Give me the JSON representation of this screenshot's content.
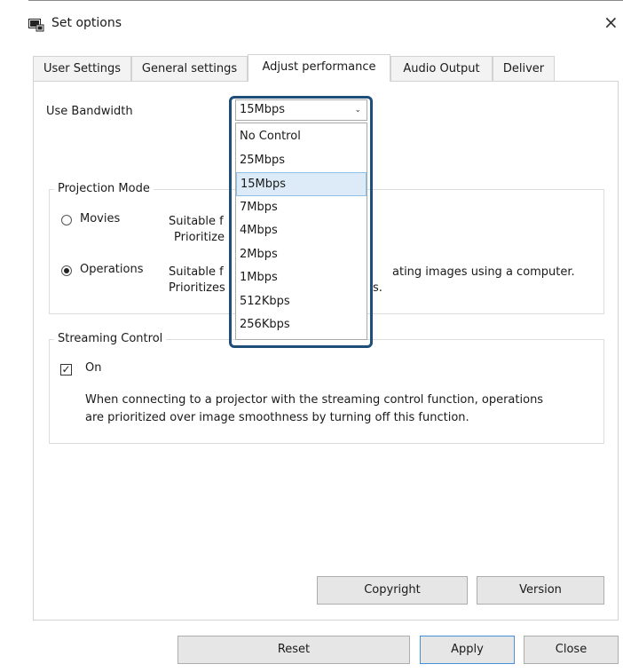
{
  "window": {
    "title": "Set options",
    "close_glyph": "×"
  },
  "tabs": [
    {
      "label": "User Settings"
    },
    {
      "label": "General settings"
    },
    {
      "label": "Adjust performance"
    },
    {
      "label": "Audio Output"
    },
    {
      "label": "Deliver"
    }
  ],
  "bandwidth": {
    "label": "Use Bandwidth",
    "selected": "15Mbps",
    "options": [
      "No Control",
      "25Mbps",
      "15Mbps",
      "7Mbps",
      "4Mbps",
      "2Mbps",
      "1Mbps",
      "512Kbps",
      "256Kbps"
    ]
  },
  "projection_mode": {
    "title": "Projection Mode",
    "movies": {
      "label": "Movies",
      "desc_line1": "Suitable f",
      "desc_line2": "Prioritize"
    },
    "operations": {
      "label": "Operations",
      "desc_line1": "Suitable f",
      "desc_line1_tail": "ating images using a computer.",
      "desc_line2": "Prioritizes",
      "desc_line2_tail": "s."
    }
  },
  "streaming_control": {
    "title": "Streaming Control",
    "checkbox_label": "On",
    "checked": true,
    "desc_line1": "When connecting to a projector with the streaming control function, operations",
    "desc_line2": "are prioritized over image smoothness by turning off this function."
  },
  "panel_buttons": {
    "copyright": "Copyright",
    "version": "Version"
  },
  "footer_buttons": {
    "reset": "Reset",
    "apply": "Apply",
    "close": "Close"
  }
}
